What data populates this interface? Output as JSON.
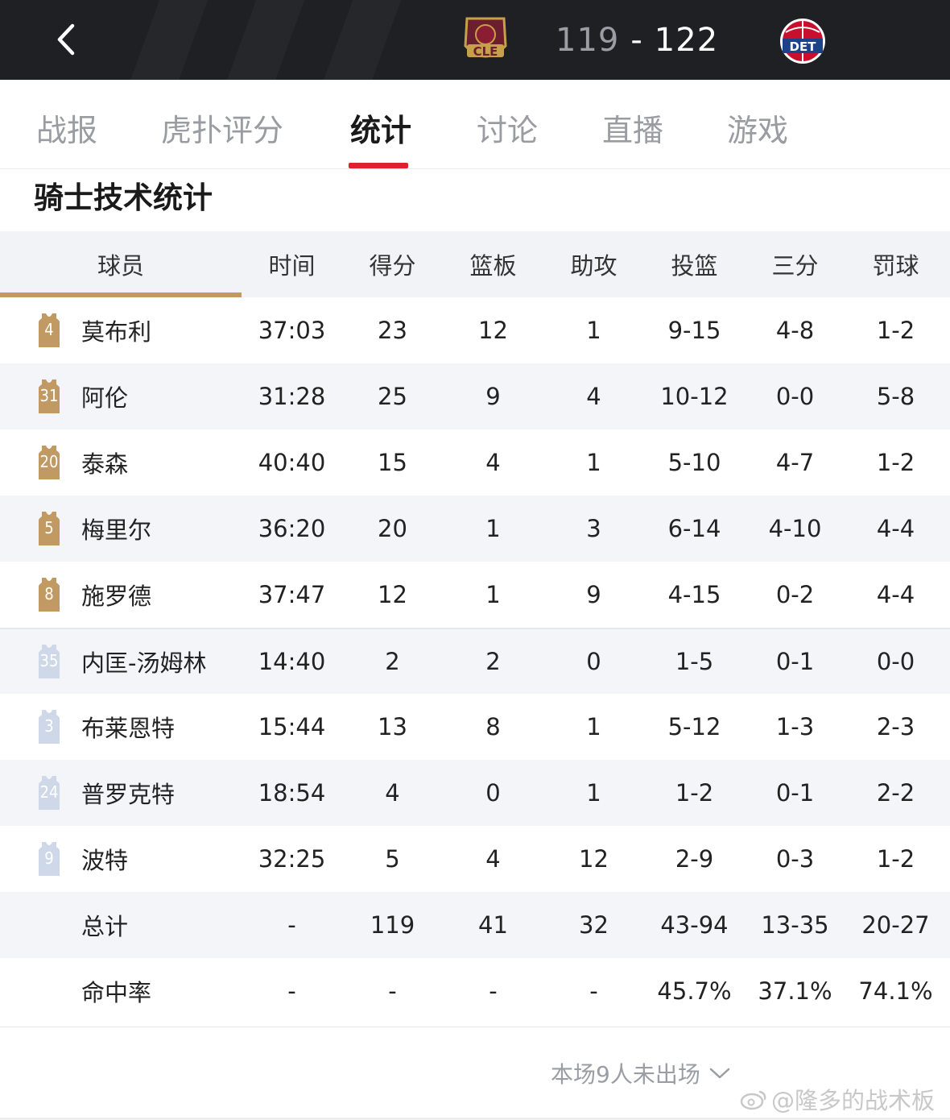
{
  "header": {
    "home_score": "119",
    "separator": "-",
    "away_score": "122",
    "home_team_abbr": "CLE",
    "away_team_abbr": "DET",
    "icons": {
      "back": "chevron-left-icon"
    }
  },
  "tabs": [
    {
      "label": "战报"
    },
    {
      "label": "虎扑评分"
    },
    {
      "label": "统计",
      "active": true
    },
    {
      "label": "讨论"
    },
    {
      "label": "直播"
    },
    {
      "label": "游戏"
    }
  ],
  "section_title": "骑士技术统计",
  "columns": [
    "球员",
    "时间",
    "得分",
    "篮板",
    "助攻",
    "投篮",
    "三分",
    "罚球"
  ],
  "starters": [
    {
      "number": "4",
      "name": "莫布利",
      "min": "37:03",
      "pts": "23",
      "reb": "12",
      "ast": "1",
      "fg": "9-15",
      "tp": "4-8",
      "ft": "1-2"
    },
    {
      "number": "31",
      "name": "阿伦",
      "min": "31:28",
      "pts": "25",
      "reb": "9",
      "ast": "4",
      "fg": "10-12",
      "tp": "0-0",
      "ft": "5-8"
    },
    {
      "number": "20",
      "name": "泰森",
      "min": "40:40",
      "pts": "15",
      "reb": "4",
      "ast": "1",
      "fg": "5-10",
      "tp": "4-7",
      "ft": "1-2"
    },
    {
      "number": "5",
      "name": "梅里尔",
      "min": "36:20",
      "pts": "20",
      "reb": "1",
      "ast": "3",
      "fg": "6-14",
      "tp": "4-10",
      "ft": "4-4"
    },
    {
      "number": "8",
      "name": "施罗德",
      "min": "37:47",
      "pts": "12",
      "reb": "1",
      "ast": "9",
      "fg": "4-15",
      "tp": "0-2",
      "ft": "4-4"
    }
  ],
  "bench": [
    {
      "number": "35",
      "name": "内匡-汤姆林",
      "min": "14:40",
      "pts": "2",
      "reb": "2",
      "ast": "0",
      "fg": "1-5",
      "tp": "0-1",
      "ft": "0-0"
    },
    {
      "number": "3",
      "name": "布莱恩特",
      "min": "15:44",
      "pts": "13",
      "reb": "8",
      "ast": "1",
      "fg": "5-12",
      "tp": "1-3",
      "ft": "2-3"
    },
    {
      "number": "24",
      "name": "普罗克特",
      "min": "18:54",
      "pts": "4",
      "reb": "0",
      "ast": "1",
      "fg": "1-2",
      "tp": "0-1",
      "ft": "2-2"
    },
    {
      "number": "9",
      "name": "波特",
      "min": "32:25",
      "pts": "5",
      "reb": "4",
      "ast": "12",
      "fg": "2-9",
      "tp": "0-3",
      "ft": "1-2"
    }
  ],
  "totals": {
    "label": "总计",
    "min": "-",
    "pts": "119",
    "reb": "41",
    "ast": "32",
    "fg": "43-94",
    "tp": "13-35",
    "ft": "20-27"
  },
  "percentages": {
    "label": "命中率",
    "min": "-",
    "pts": "-",
    "reb": "-",
    "ast": "-",
    "fg": "45.7%",
    "tp": "37.1%",
    "ft": "74.1%"
  },
  "footer": {
    "dnp_label": "本场9人未出场",
    "watermark": "@隆多的战术板"
  },
  "colors": {
    "header_bg": "#1f2024",
    "accent_red": "#e0202b",
    "starter_jersey": "#c19a63",
    "bench_jersey": "#cfd8e8"
  }
}
